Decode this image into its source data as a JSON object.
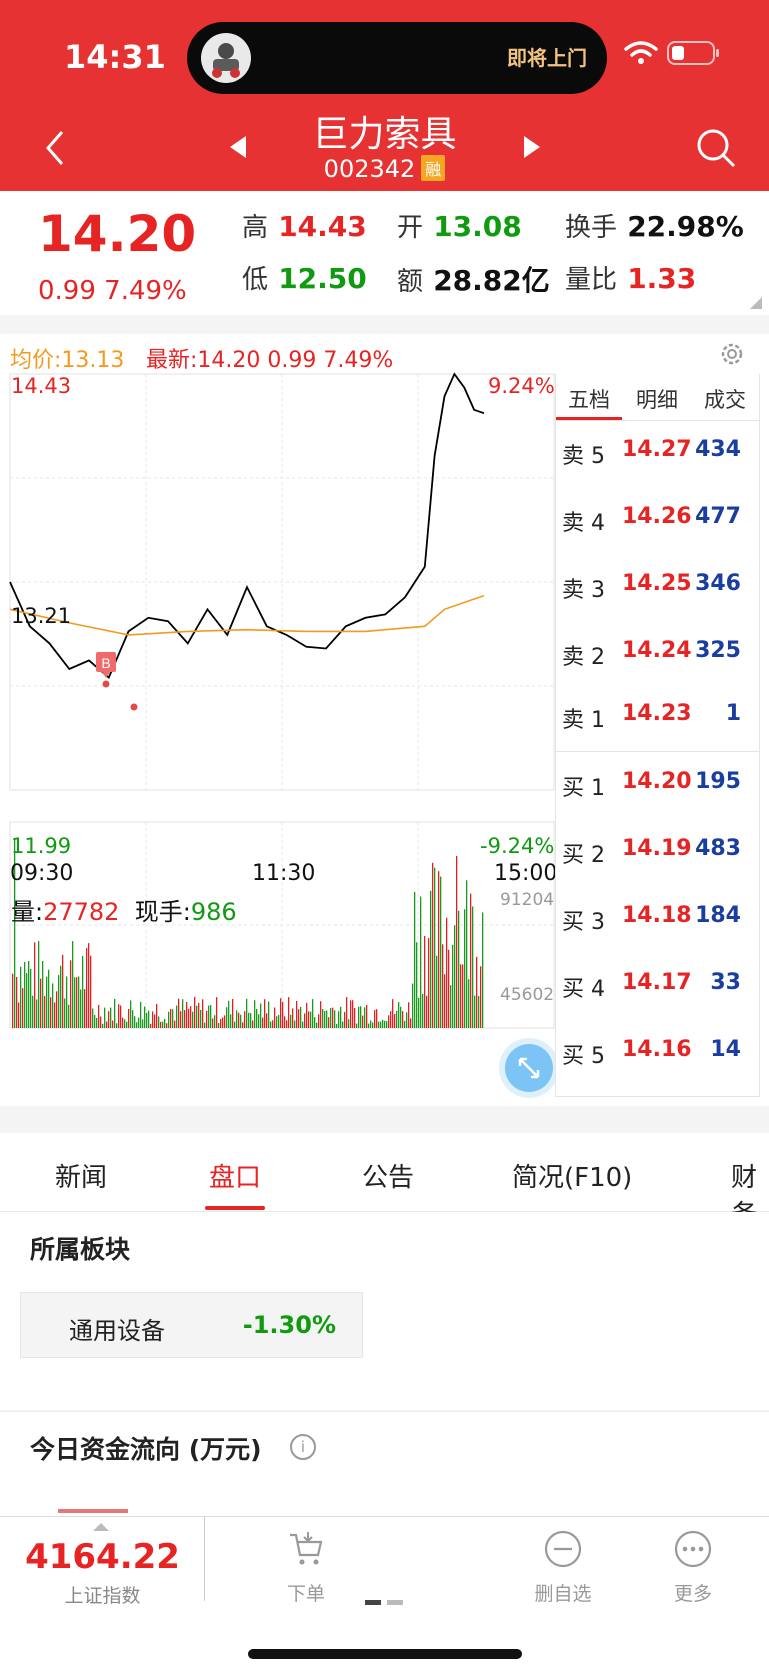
{
  "status_bar": {
    "time": "14:31",
    "island_text": "即将上门"
  },
  "header": {
    "stock_name": "巨力索具",
    "stock_code": "002342",
    "badge": "融"
  },
  "quote": {
    "price": "14.20",
    "change": "0.99  7.49%",
    "fields": [
      {
        "label": "高",
        "value": "14.43",
        "color": "#e62424"
      },
      {
        "label": "开",
        "value": "13.08",
        "color": "#109a10"
      },
      {
        "label": "换手",
        "value": "22.98%",
        "color": "#111111"
      },
      {
        "label": "低",
        "value": "12.50",
        "color": "#109a10"
      },
      {
        "label": "额",
        "value": "28.82亿",
        "color": "#111111"
      },
      {
        "label": "量比",
        "value": "1.33",
        "color": "#e62424"
      }
    ]
  },
  "chart": {
    "avg_price": "均价:13.13",
    "latest": "最新:14.20  0.99  7.49%",
    "price_top": "14.43",
    "pct_top": "9.24%",
    "price_mid": "13.21",
    "price_low": "11.99",
    "pct_low": "-9.24%",
    "times": [
      "09:30",
      "11:30",
      "15:00"
    ],
    "volume_label": "量:",
    "volume_value": "27782",
    "current_hand_label": "现手:",
    "current_hand_value": "986",
    "vol_max": "91204",
    "vol_mid": "45602",
    "buy_marker": "B"
  },
  "chart_data": {
    "type": "line",
    "title": "",
    "ylim": [
      11.99,
      14.43
    ],
    "series": [
      {
        "name": "价格",
        "color": "#000000",
        "x": [
          "09:30",
          "09:40",
          "09:50",
          "10:00",
          "10:10",
          "10:20",
          "10:30",
          "10:40",
          "10:50",
          "11:00",
          "11:10",
          "11:20",
          "11:30",
          "13:10",
          "13:20",
          "13:30",
          "13:40",
          "13:50",
          "14:00",
          "14:10",
          "14:20",
          "14:30",
          "14:35",
          "14:40",
          "14:45",
          "14:50",
          "14:55",
          "15:00"
        ],
        "y": [
          13.21,
          12.95,
          12.85,
          12.7,
          12.75,
          12.65,
          12.92,
          13.0,
          12.98,
          12.85,
          13.05,
          12.9,
          13.18,
          12.95,
          12.9,
          12.83,
          12.82,
          12.95,
          13.0,
          13.02,
          13.12,
          13.3,
          13.95,
          14.3,
          14.43,
          14.35,
          14.22,
          14.2
        ]
      },
      {
        "name": "均价",
        "color": "#f39a1e",
        "x": [
          "09:30",
          "10:00",
          "10:30",
          "11:00",
          "11:30",
          "13:30",
          "14:00",
          "14:30",
          "14:40",
          "15:00"
        ],
        "y": [
          13.05,
          12.97,
          12.9,
          12.92,
          12.93,
          12.92,
          12.92,
          12.95,
          13.05,
          13.13
        ]
      }
    ]
  },
  "order_book": {
    "tabs": [
      "五档",
      "明细",
      "成交"
    ],
    "asks": [
      {
        "name": "卖 5",
        "price": "14.27",
        "vol": "434"
      },
      {
        "name": "卖 4",
        "price": "14.26",
        "vol": "477"
      },
      {
        "name": "卖 3",
        "price": "14.25",
        "vol": "346"
      },
      {
        "name": "卖 2",
        "price": "14.24",
        "vol": "325"
      },
      {
        "name": "卖 1",
        "price": "14.23",
        "vol": "1"
      }
    ],
    "bids": [
      {
        "name": "买 1",
        "price": "14.20",
        "vol": "195"
      },
      {
        "name": "买 2",
        "price": "14.19",
        "vol": "483"
      },
      {
        "name": "买 3",
        "price": "14.18",
        "vol": "184"
      },
      {
        "name": "买 4",
        "price": "14.17",
        "vol": "33"
      },
      {
        "name": "买 5",
        "price": "14.16",
        "vol": "14"
      }
    ]
  },
  "tabs": [
    "新闻",
    "盘口",
    "公告",
    "简况(F10)",
    "财务"
  ],
  "active_tab": "盘口",
  "sector": {
    "title": "所属板块",
    "name": "通用设备",
    "change": "-1.30%"
  },
  "money_flow": {
    "title": "今日资金流向 (万元)",
    "info_icon": "i"
  },
  "bottom_bar": {
    "index_value": "4164.22",
    "index_name": "上证指数",
    "buttons": [
      {
        "label": "下单",
        "icon": "cart-icon"
      },
      {
        "label": "删自选",
        "icon": "minus-circle-icon"
      },
      {
        "label": "更多",
        "icon": "more-icon"
      }
    ]
  }
}
